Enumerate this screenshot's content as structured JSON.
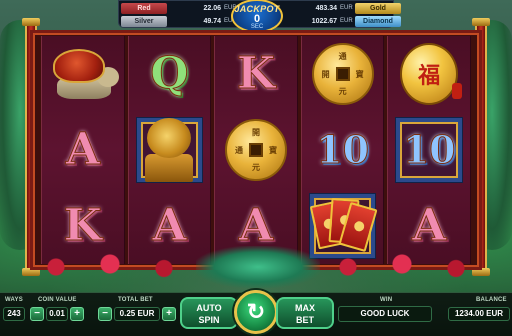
{
  "jackpots": {
    "red": {
      "label": "Red",
      "value": "22.06",
      "currency": "EUR"
    },
    "silver": {
      "label": "Silver",
      "value": "49.74",
      "currency": "EUR"
    },
    "gold": {
      "label": "Gold",
      "value": "483.34",
      "currency": "EUR"
    },
    "diamond": {
      "label": "Diamond",
      "value": "1022.67",
      "currency": "EUR"
    },
    "center": {
      "title": "JACKPOT",
      "countdown": "0",
      "unit": "SEC"
    }
  },
  "reels": [
    [
      {
        "symbol": "turtle-icon"
      },
      {
        "symbol": "letter",
        "text": "A",
        "color": "pink"
      },
      {
        "symbol": "letter",
        "text": "K",
        "color": "pink"
      }
    ],
    [
      {
        "symbol": "letter",
        "text": "Q",
        "color": "green"
      },
      {
        "symbol": "lion-icon"
      },
      {
        "symbol": "letter",
        "text": "A",
        "color": "pink"
      }
    ],
    [
      {
        "symbol": "letter",
        "text": "K",
        "color": "pink"
      },
      {
        "symbol": "coin-icon",
        "glyphs": [
          "開",
          "元",
          "通",
          "寶"
        ]
      },
      {
        "symbol": "letter",
        "text": "A",
        "color": "pink"
      }
    ],
    [
      {
        "symbol": "coin-icon",
        "glyphs": [
          "通",
          "元",
          "開",
          "寶"
        ]
      },
      {
        "symbol": "letter",
        "text": "10",
        "color": "blue"
      },
      {
        "symbol": "envelopes-icon"
      }
    ],
    [
      {
        "symbol": "lantern-icon",
        "glyph": "福"
      },
      {
        "symbol": "letter",
        "text": "10",
        "color": "blue"
      },
      {
        "symbol": "letter",
        "text": "A",
        "color": "pink"
      }
    ]
  ],
  "bottom": {
    "ways_label": "WAYS",
    "ways_value": "243",
    "coin_value_label": "COIN VALUE",
    "coin_value": "0.01",
    "total_bet_label": "TOTAL BET",
    "total_bet": "0.25 EUR",
    "autospin_line1": "AUTO",
    "autospin_line2": "SPIN",
    "maxbet_line1": "MAX",
    "maxbet_line2": "BET",
    "win_label": "WIN",
    "message": "GOOD LUCK",
    "balance_label": "BALANCE",
    "balance": "1234.00 EUR",
    "minus": "−",
    "plus": "+"
  },
  "colors": {
    "reel_bg": "#5d1330",
    "frame_red": "#7a1b14",
    "ui_green": "#27955a",
    "gold_trim": "#e8c34a"
  }
}
